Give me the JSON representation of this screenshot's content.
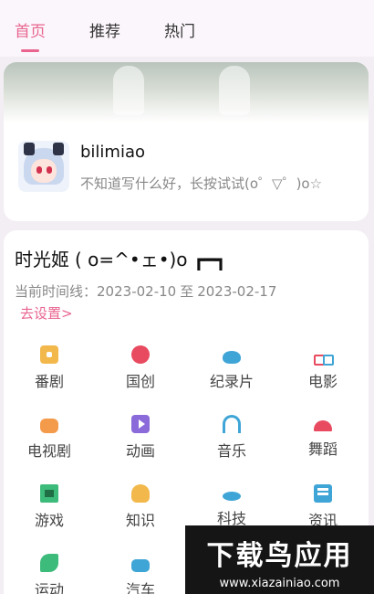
{
  "tabs": [
    {
      "label": "首页",
      "active": true
    },
    {
      "label": "推荐",
      "active": false
    },
    {
      "label": "热门",
      "active": false
    }
  ],
  "profile": {
    "username": "bilimiao",
    "bio": "不知道写什么好，长按试试(o゜▽゜)o☆"
  },
  "site": {
    "title": "时光姬",
    "kaomoji": "( o=^•ェ•)o ┏━┓",
    "timeline_label": "当前时间线：",
    "timeline_start": "2023-02-10",
    "timeline_sep": "至",
    "timeline_end": "2023-02-17",
    "settings_link": "去设置>"
  },
  "categories": [
    {
      "label": "番剧",
      "icon": "tv-icon"
    },
    {
      "label": "国创",
      "icon": "apple-icon"
    },
    {
      "label": "纪录片",
      "icon": "whale-icon"
    },
    {
      "label": "电影",
      "icon": "3d-glasses-icon"
    },
    {
      "label": "电视剧",
      "icon": "sofa-icon"
    },
    {
      "label": "动画",
      "icon": "play-icon"
    },
    {
      "label": "音乐",
      "icon": "headphones-icon"
    },
    {
      "label": "舞蹈",
      "icon": "fan-icon"
    },
    {
      "label": "游戏",
      "icon": "creeper-icon"
    },
    {
      "label": "知识",
      "icon": "lightbulb-icon"
    },
    {
      "label": "科技",
      "icon": "ufo-icon"
    },
    {
      "label": "资讯",
      "icon": "newspaper-icon"
    },
    {
      "label": "运动",
      "icon": "running-icon"
    },
    {
      "label": "汽车",
      "icon": "car-icon"
    }
  ],
  "watermark": {
    "title": "下载鸟应用",
    "url": "www.xiazainiao.com"
  },
  "colors": {
    "accent": "#e9658f",
    "background": "#f3eef3"
  }
}
